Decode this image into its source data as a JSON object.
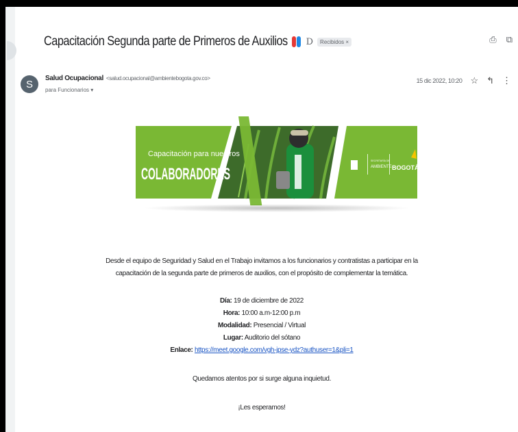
{
  "email": {
    "subject": "Capacitación Segunda parte de Primeros de Auxilios",
    "important_marker": "D",
    "label": "Recibidos ×",
    "sender": {
      "avatar_letter": "S",
      "name": "Salud Ocupacional",
      "email": "<salud.ocupacional@ambientebogota.gov.co>",
      "recipient": "para Funcionarios ▾"
    },
    "date": "15 dic 2022, 10:20"
  },
  "banner": {
    "line1": "Capacitación para nuestros",
    "line2": "COLABORADORES",
    "org1": "SECRETARÍA DE",
    "org2": "AMBIENTE",
    "city": "BOGOTÁ",
    "colors": {
      "green": "#7ab834",
      "dark_green": "#4e8f1e"
    }
  },
  "message": {
    "intro_line1": "Desde el equipo de Seguridad y Salud en el Trabajo invitamos a los funcionarios y contratistas  a participar en la",
    "intro_line2": "capacitación de la segunda parte de primeros de auxilios, con el propósito de complementar la temática.",
    "details": [
      {
        "label": "Día:",
        "value": " 19 de diciembre de 2022"
      },
      {
        "label": "Hora:",
        "value": " 10:00 a.m-12:00 p.m"
      },
      {
        "label": "Modalidad:",
        "value": " Presencial / Virtual"
      },
      {
        "label": "Lugar:",
        "value": " Auditorio del sótano"
      }
    ],
    "link_label": "Enlace:",
    "link_url": "https://meet.google.com/vgh-jpse-ydz?authuser=1&pli=1",
    "closing": "Quedamos atentos por si surge alguna inquietud.",
    "farewell": "¡Les esperamos!"
  },
  "icons": {
    "print": "print-icon",
    "open_new": "open-in-new-icon",
    "star": "star-icon",
    "reply": "reply-icon",
    "more": "more-vert-icon"
  }
}
